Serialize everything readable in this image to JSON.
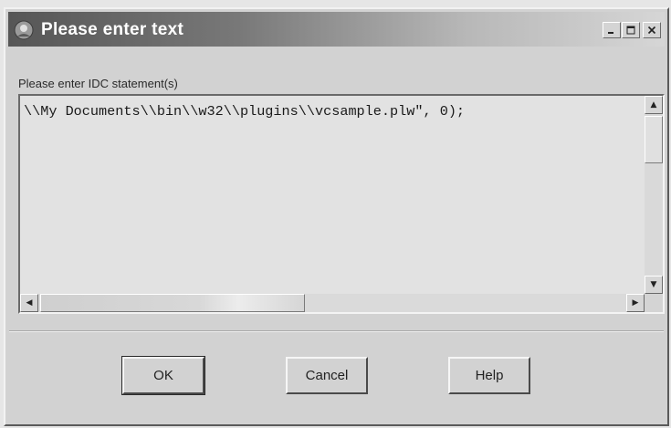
{
  "window": {
    "title": "Please enter text",
    "controls": {
      "minimize": "minimize-icon",
      "maximize": "maximize-icon",
      "close": "close-icon"
    }
  },
  "prompt": {
    "label": "Please enter IDC statement(s)"
  },
  "editor": {
    "value": "\\\\My Documents\\\\bin\\\\w32\\\\plugins\\\\vcsample.plw\", 0);"
  },
  "scrollbars": {
    "up_icon": "arrow-up-icon",
    "down_icon": "arrow-down-icon",
    "left_icon": "arrow-left-icon",
    "right_icon": "arrow-right-icon"
  },
  "buttons": {
    "ok": "OK",
    "cancel": "Cancel",
    "help": "Help"
  },
  "colors": {
    "face": "#d2d2d2",
    "titlebar_start": "#565656",
    "titlebar_end": "#d6d6d6"
  }
}
